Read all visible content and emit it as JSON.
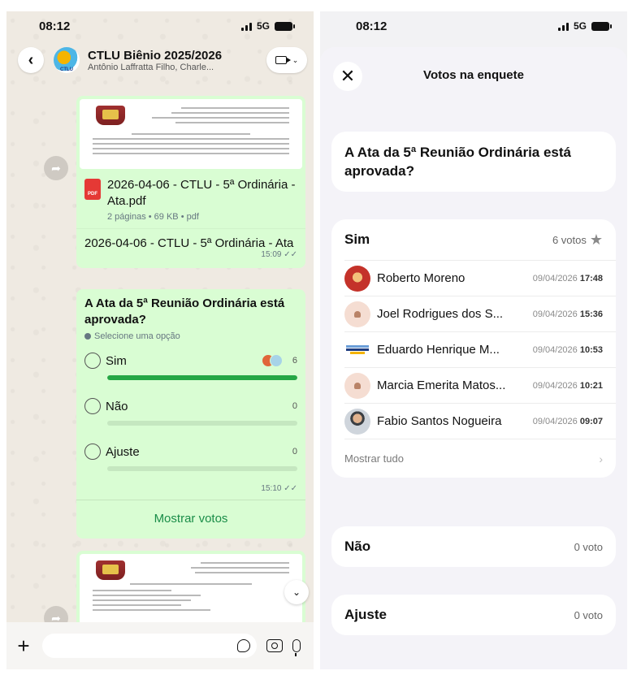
{
  "left": {
    "status": {
      "time": "08:12",
      "network": "5G"
    },
    "header": {
      "title": "CTLU Biênio 2025/2026",
      "subtitle": "Antônio Laffratta Filho, Charle...",
      "avatar_text": "CTLU"
    },
    "document": {
      "name": "2026-04-06 - CTLU - 5ª Ordinária - Ata.pdf",
      "meta": "2 páginas • 69 KB • pdf",
      "type_label": "PDF",
      "caption": "2026-04-06 - CTLU - 5ª Ordinária - Ata",
      "time": "15:09"
    },
    "poll": {
      "question": "A Ata da 5ª Reunião Ordinária está aprovada?",
      "hint": "Selecione uma opção",
      "options": [
        {
          "label": "Sim",
          "count": "6",
          "fill": 1.0
        },
        {
          "label": "Não",
          "count": "0",
          "fill": 0.0
        },
        {
          "label": "Ajuste",
          "count": "0",
          "fill": 0.0
        }
      ],
      "time": "15:10",
      "show_votes": "Mostrar votos"
    },
    "input": {
      "placeholder": ""
    }
  },
  "right": {
    "status": {
      "time": "08:12",
      "network": "5G"
    },
    "title": "Votos na enquete",
    "question": "A Ata da 5ª Reunião Ordinária está aprovada?",
    "options": [
      {
        "name": "Sim",
        "votes": "6 votos",
        "voters": [
          {
            "name": "Roberto Moreno",
            "date": "09/04/2026",
            "time": "17:48"
          },
          {
            "name": "Joel Rodrigues dos S...",
            "date": "09/04/2026",
            "time": "15:36"
          },
          {
            "name": "Eduardo Henrique M...",
            "date": "09/04/2026",
            "time": "10:53"
          },
          {
            "name": "Marcia Emerita Matos...",
            "date": "09/04/2026",
            "time": "10:21"
          },
          {
            "name": "Fabio Santos Nogueira",
            "date": "09/04/2026",
            "time": "09:07"
          }
        ],
        "show_all": "Mostrar tudo"
      },
      {
        "name": "Não",
        "votes": "0 voto"
      },
      {
        "name": "Ajuste",
        "votes": "0 voto"
      }
    ]
  },
  "colors": {
    "chat_bg": "#efeae2",
    "bubble": "#d9fdd3",
    "poll_fill": "#25a745",
    "link_green": "#1a8d48",
    "sheet_bg": "#f4f3f8"
  },
  "icons": [
    "back-chevron-icon",
    "video-call-icon",
    "forward-icon",
    "pdf-icon",
    "check-icon",
    "scroll-down-icon",
    "plus-icon",
    "sticker-icon",
    "camera-icon",
    "mic-icon",
    "close-icon",
    "star-icon",
    "chevron-right-icon"
  ]
}
